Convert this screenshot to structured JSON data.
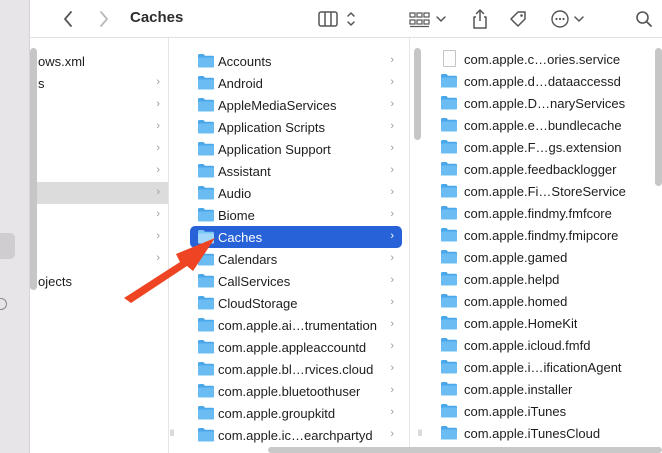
{
  "window": {
    "title": "Caches"
  },
  "toolbar": {
    "back_icon": "chevron-left-icon",
    "forward_icon": "chevron-right-icon",
    "view_icon": "columns-view-icon",
    "group_icon": "group-grid-icon",
    "share_icon": "share-icon",
    "tag_icon": "tag-icon",
    "action_icon": "more-actions-icon",
    "search_icon": "search-icon"
  },
  "column1": {
    "items": [
      {
        "label": "ows.xml",
        "chevron": ""
      },
      {
        "label": "s",
        "chevron": "›"
      },
      {
        "label": "",
        "chevron": "›"
      },
      {
        "label": "",
        "chevron": "›"
      },
      {
        "label": "",
        "chevron": "›"
      },
      {
        "label": "",
        "chevron": "›"
      },
      {
        "label": "",
        "chevron": "›"
      },
      {
        "label": "",
        "chevron": "›"
      },
      {
        "label": "",
        "chevron": "›"
      },
      {
        "label": "",
        "chevron": "›"
      },
      {
        "label": "",
        "chevron": "›"
      },
      {
        "label": "ojects",
        "chevron": "›"
      }
    ]
  },
  "column2": {
    "items": [
      {
        "label": "Accounts",
        "chevron": "›"
      },
      {
        "label": "Android",
        "chevron": "›"
      },
      {
        "label": "AppleMediaServices",
        "chevron": "›"
      },
      {
        "label": "Application Scripts",
        "chevron": "›"
      },
      {
        "label": "Application Support",
        "chevron": "›"
      },
      {
        "label": "Assistant",
        "chevron": "›"
      },
      {
        "label": "Audio",
        "chevron": "›"
      },
      {
        "label": "Biome",
        "chevron": "›"
      },
      {
        "label": "Caches",
        "chevron": "›"
      },
      {
        "label": "Calendars",
        "chevron": "›"
      },
      {
        "label": "CallServices",
        "chevron": "›"
      },
      {
        "label": "CloudStorage",
        "chevron": "›"
      },
      {
        "label": "com.apple.ai…trumentation",
        "chevron": "›"
      },
      {
        "label": "com.apple.appleaccountd",
        "chevron": "›"
      },
      {
        "label": "com.apple.bl…rvices.cloud",
        "chevron": "›"
      },
      {
        "label": "com.apple.bluetoothuser",
        "chevron": "›"
      },
      {
        "label": "com.apple.groupkitd",
        "chevron": "›"
      },
      {
        "label": "com.apple.ic…earchpartyd",
        "chevron": "›"
      }
    ]
  },
  "column3": {
    "items": [
      {
        "label": "com.apple.c…ories.service",
        "type": "file"
      },
      {
        "label": "com.apple.d…dataaccessd",
        "type": "folder"
      },
      {
        "label": "com.apple.D…naryServices",
        "type": "folder"
      },
      {
        "label": "com.apple.e…bundlecache",
        "type": "folder"
      },
      {
        "label": "com.apple.F…gs.extension",
        "type": "folder"
      },
      {
        "label": "com.apple.feedbacklogger",
        "type": "folder"
      },
      {
        "label": "com.apple.Fi…StoreService",
        "type": "folder"
      },
      {
        "label": "com.apple.findmy.fmfcore",
        "type": "folder"
      },
      {
        "label": "com.apple.findmy.fmipcore",
        "type": "folder"
      },
      {
        "label": "com.apple.gamed",
        "type": "folder"
      },
      {
        "label": "com.apple.helpd",
        "type": "folder"
      },
      {
        "label": "com.apple.homed",
        "type": "folder"
      },
      {
        "label": "com.apple.HomeKit",
        "type": "folder"
      },
      {
        "label": "com.apple.icloud.fmfd",
        "type": "folder"
      },
      {
        "label": "com.apple.i…ificationAgent",
        "type": "folder"
      },
      {
        "label": "com.apple.installer",
        "type": "folder"
      },
      {
        "label": "com.apple.iTunes",
        "type": "folder"
      },
      {
        "label": "com.apple.iTunesCloud",
        "type": "folder"
      }
    ]
  },
  "colors": {
    "selection": "#2862d8",
    "folder": "#4aa8ea",
    "arrow": "#ef4423"
  }
}
